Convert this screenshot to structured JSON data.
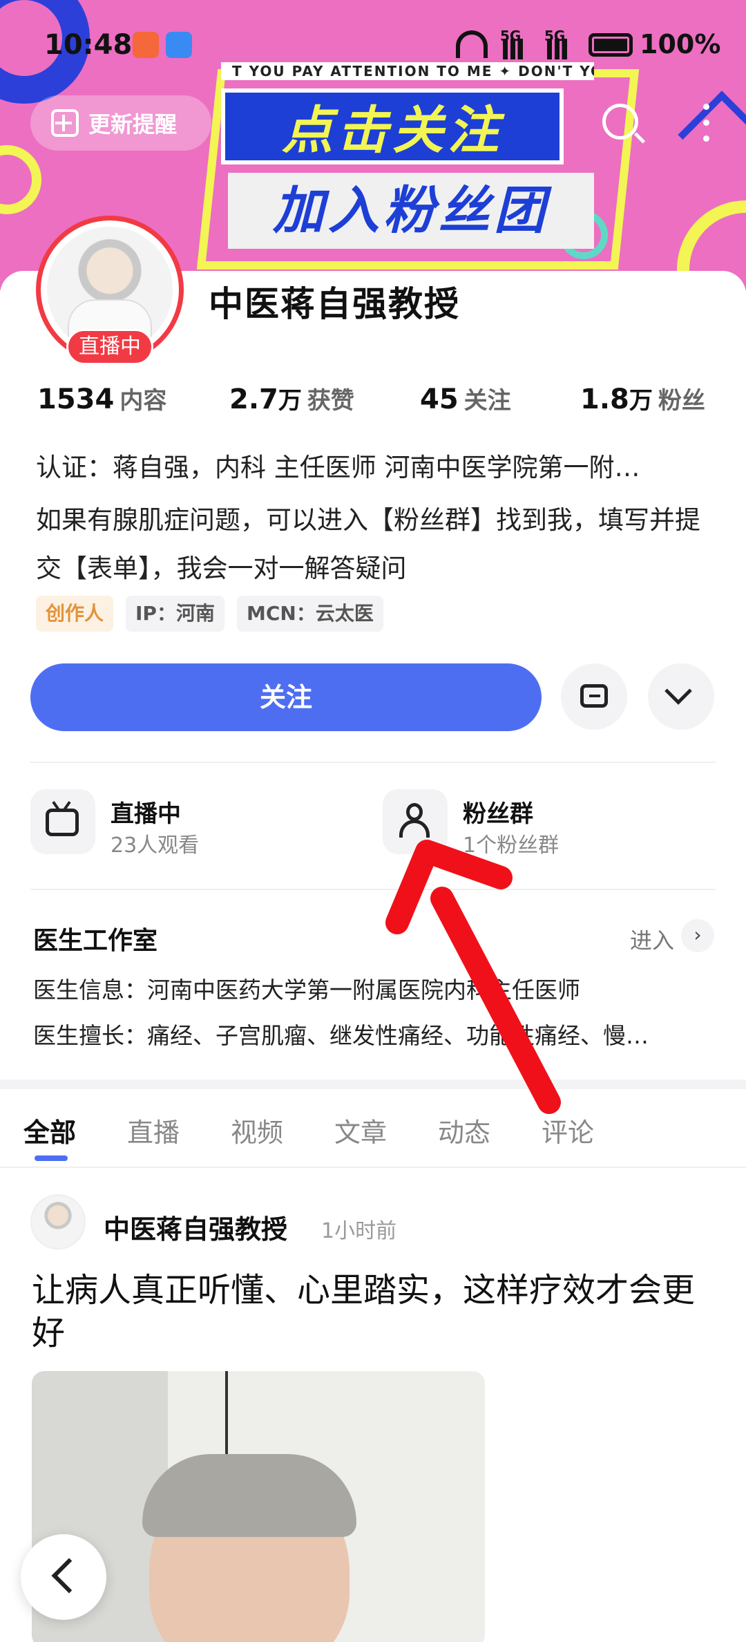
{
  "status_bar": {
    "time": "10:48",
    "network_1": "5G",
    "network_2": "5G",
    "battery": "100%"
  },
  "banner": {
    "update_button": "更新提醒",
    "marquee": "T YOU PAY ATTENTION TO ME ✦ DON'T YO",
    "headline_1": "点击关注",
    "headline_2": "加入粉丝团"
  },
  "profile": {
    "name": "中医蒋自强教授",
    "live_badge": "直播中",
    "stats": [
      {
        "value": "1534",
        "unit": "",
        "label": "内容"
      },
      {
        "value": "2.7",
        "unit": "万",
        "label": "获赞"
      },
      {
        "value": "45",
        "unit": "",
        "label": "关注"
      },
      {
        "value": "1.8",
        "unit": "万",
        "label": "粉丝"
      }
    ],
    "certification": "认证：蒋自强，内科 主任医师 河南中医学院第一附…",
    "bio": "如果有腺肌症问题，可以进入【粉丝群】找到我，填写并提交【表单】，我会一对一解答疑问",
    "tags": [
      "创作人",
      "IP：河南",
      "MCN：云太医"
    ],
    "follow_button": "关注"
  },
  "entries": [
    {
      "title": "直播中",
      "subtitle": "23人观看"
    },
    {
      "title": "粉丝群",
      "subtitle": "1个粉丝群"
    }
  ],
  "studio": {
    "title": "医生工作室",
    "enter": "进入",
    "info": "医生信息：河南中医药大学第一附属医院内科主任医师",
    "specialty": "医生擅长：痛经、子宫肌瘤、继发性痛经、功能性痛经、慢…"
  },
  "tabs": [
    "全部",
    "直播",
    "视频",
    "文章",
    "动态",
    "评论"
  ],
  "post": {
    "author": "中医蒋自强教授",
    "time": "1小时前",
    "title": "让病人真正听懂、心里踏实，这样疗效才会更好"
  },
  "colors": {
    "accent": "#4e6ef2",
    "live_red": "#f23a44",
    "banner_pink": "#ec6fc1",
    "annotation_arrow": "#f0101a"
  }
}
